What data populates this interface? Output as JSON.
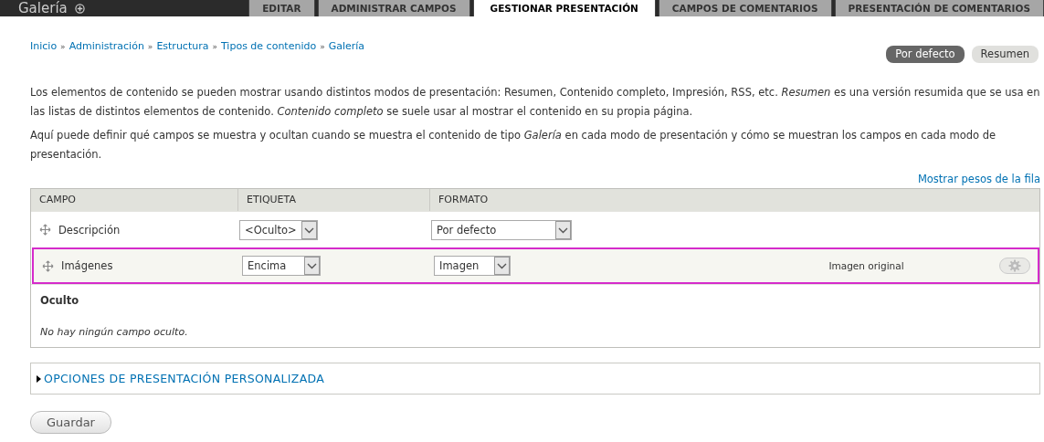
{
  "header": {
    "title": "Galería",
    "add_icon": true,
    "tabs": [
      {
        "label": "EDITAR",
        "selected": false
      },
      {
        "label": "ADMINISTRAR CAMPOS",
        "selected": false
      },
      {
        "label": "GESTIONAR PRESENTACIÓN",
        "selected": true
      },
      {
        "label": "CAMPOS DE COMENTARIOS",
        "selected": false
      },
      {
        "label": "PRESENTACIÓN DE COMENTARIOS",
        "selected": false
      }
    ]
  },
  "breadcrumb": [
    "Inicio",
    "Administración",
    "Estructura",
    "Tipos de contenido",
    "Galería"
  ],
  "breadcrumb_separator": "»",
  "view_modes": [
    {
      "label": "Por defecto",
      "selected": true
    },
    {
      "label": "Resumen",
      "selected": false
    }
  ],
  "description": [
    "Los elementos de contenido se pueden mostrar usando distintos modos de presentación: Resumen, Contenido completo, Impresión, RSS, etc. *Resumen* es una versión resumida que se usa en las listas de distintos elementos de contenido. *Contenido completo* se suele usar al mostrar el contenido en su propia página.",
    "Aquí puede definir qué campos se muestra y ocultan cuando se muestra el contenido de tipo *Galería* en cada modo de presentación y cómo se muestran los campos en cada modo de presentación."
  ],
  "row_weights_link": "Mostrar pesos de la fila",
  "table": {
    "columns": [
      "CAMPO",
      "ETIQUETA",
      "FORMATO"
    ],
    "rows": [
      {
        "field": "Descripción",
        "label": "<Oculto>",
        "format": "Por defecto",
        "selected": false
      },
      {
        "field": "Imágenes",
        "label": "Encima",
        "format": "Imagen",
        "summary": "Imagen original",
        "settings": true,
        "selected": true
      }
    ],
    "hidden_region": {
      "title": "Oculto",
      "empty": "No hay ningún campo oculto."
    }
  },
  "fieldset": {
    "title": "OPCIONES DE PRESENTACIÓN PERSONALIZADA",
    "expanded": false
  },
  "save_button": "Guardar"
}
